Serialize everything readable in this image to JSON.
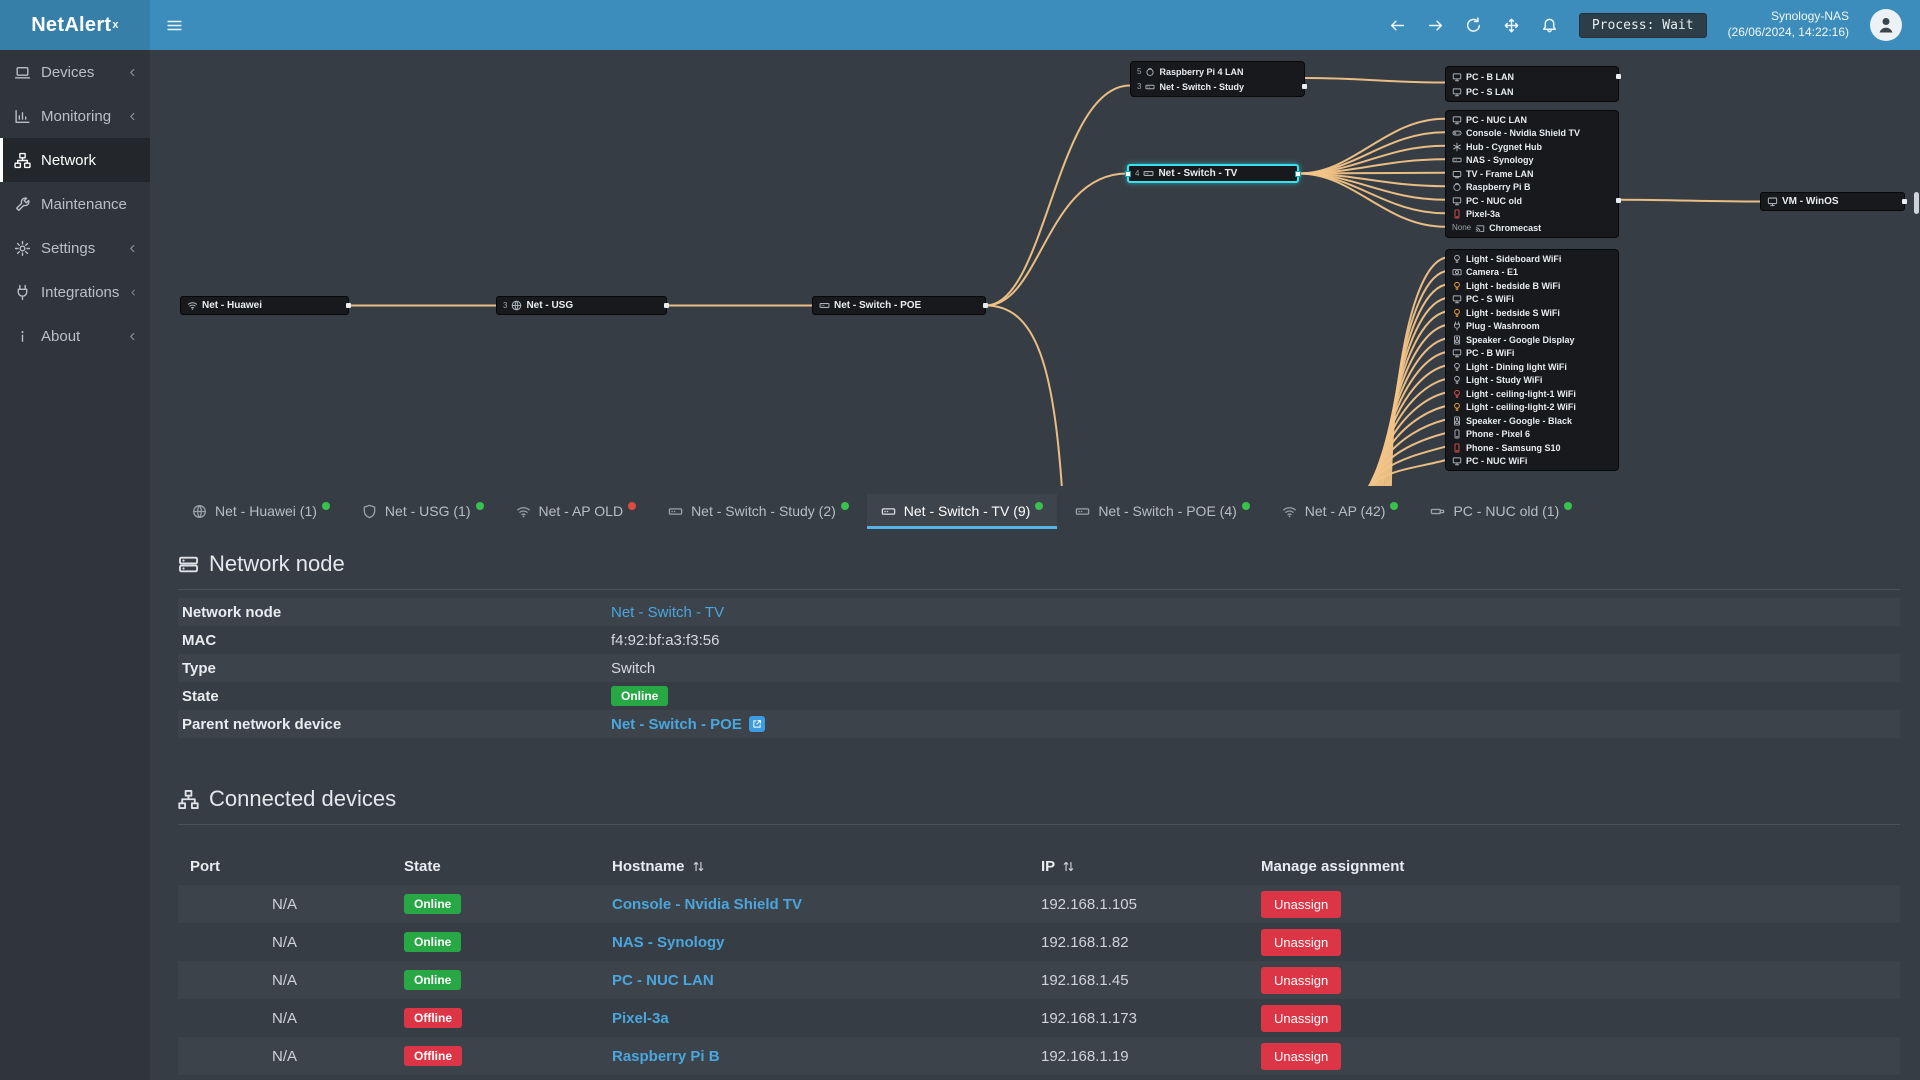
{
  "app": {
    "name": "NetAlert",
    "sup": "x"
  },
  "topbar": {
    "process": "Process: Wait",
    "host": "Synology-NAS",
    "time": "(26/06/2024, 14:22:16)"
  },
  "colors": {
    "accent": "#3c8dbc",
    "line": "#f2c488",
    "online": "#28a745",
    "offline": "#dc3545",
    "link": "#4aa6dc",
    "selection": "#35e3ee"
  },
  "sidebar": {
    "items": [
      {
        "label": "Devices",
        "icon": "laptop",
        "chevron": true
      },
      {
        "label": "Monitoring",
        "icon": "chart",
        "chevron": true
      },
      {
        "label": "Network",
        "icon": "network",
        "active": true
      },
      {
        "label": "Maintenance",
        "icon": "wrench",
        "chevron": true
      },
      {
        "label": "Settings",
        "icon": "gear",
        "chevron": true
      },
      {
        "label": "Integrations",
        "icon": "plug",
        "chevron": true
      },
      {
        "label": "About",
        "icon": "info",
        "chevron": true
      }
    ]
  },
  "topology": {
    "nodes": [
      {
        "id": "huawei",
        "label": "Net - Huawei",
        "icon": "wifi"
      },
      {
        "id": "usg",
        "label": "Net - USG",
        "icon": "globe",
        "prefix": "3"
      },
      {
        "id": "poe",
        "label": "Net - Switch - POE",
        "icon": "switch"
      },
      {
        "id": "tv",
        "label": "Net - Switch - TV",
        "icon": "switch",
        "prefix": "4",
        "selected": true
      },
      {
        "id": "vm",
        "label": "VM - WinOS",
        "icon": "pc"
      }
    ],
    "groups": [
      {
        "id": "study",
        "items": [
          {
            "label": "Raspberry Pi 4 LAN",
            "icon": "pi",
            "prefix": "5"
          },
          {
            "label": "Net - Switch - Study",
            "icon": "switch",
            "prefix": "3"
          }
        ]
      },
      {
        "id": "lan-bs",
        "items": [
          {
            "label": "PC - B LAN",
            "icon": "pc"
          },
          {
            "label": "PC - S LAN",
            "icon": "pc"
          }
        ]
      },
      {
        "id": "tv-devices",
        "items": [
          {
            "label": "PC - NUC LAN",
            "icon": "pc"
          },
          {
            "label": "Console - Nvidia Shield TV",
            "icon": "gamepad"
          },
          {
            "label": "Hub - Cygnet Hub",
            "icon": "hub"
          },
          {
            "label": "NAS - Synology",
            "icon": "nas"
          },
          {
            "label": "TV - Frame LAN",
            "icon": "tv"
          },
          {
            "label": "Raspberry Pi B",
            "icon": "pi"
          },
          {
            "label": "PC - NUC old",
            "icon": "pc"
          },
          {
            "label": "Pixel-3a",
            "icon": "phone",
            "color": "#d9534f"
          },
          {
            "label": "Chromecast",
            "icon": "cast",
            "prefix": "None"
          }
        ]
      },
      {
        "id": "wifi-devices",
        "items": [
          {
            "label": "Light - Sideboard WiFi",
            "icon": "light"
          },
          {
            "label": "Camera - E1",
            "icon": "camera"
          },
          {
            "label": "Light - bedside B WiFi",
            "icon": "light",
            "color": "#e8a33d"
          },
          {
            "label": "PC - S WiFi",
            "icon": "pc"
          },
          {
            "label": "Light - bedside S WiFi",
            "icon": "light",
            "color": "#e8a33d"
          },
          {
            "label": "Plug - Washroom",
            "icon": "plug"
          },
          {
            "label": "Speaker - Google Display",
            "icon": "speaker"
          },
          {
            "label": "PC - B WiFi",
            "icon": "pc"
          },
          {
            "label": "Light - Dining light WiFi",
            "icon": "light"
          },
          {
            "label": "Light - Study WiFi",
            "icon": "light"
          },
          {
            "label": "Light - ceiling-light-1 WiFi",
            "icon": "light",
            "color": "#d9534f"
          },
          {
            "label": "Light - ceiling-light-2 WiFi",
            "icon": "light",
            "color": "#e8a33d"
          },
          {
            "label": "Speaker - Google - Black",
            "icon": "speaker"
          },
          {
            "label": "Phone - Pixel 6",
            "icon": "phone"
          },
          {
            "label": "Phone - Samsung S10",
            "icon": "phone",
            "color": "#d9534f"
          },
          {
            "label": "PC - NUC WiFi",
            "icon": "pc"
          }
        ]
      }
    ]
  },
  "tabs": [
    {
      "label": "Net - Huawei (1)",
      "icon": "globe",
      "dot": "green"
    },
    {
      "label": "Net - USG (1)",
      "icon": "shield",
      "dot": "green"
    },
    {
      "label": "Net - AP OLD",
      "icon": "wifi",
      "dot": "red"
    },
    {
      "label": "Net - Switch - Study (2)",
      "icon": "switch",
      "dot": "green"
    },
    {
      "label": "Net - Switch - TV (9)",
      "icon": "switch",
      "dot": "green",
      "active": true
    },
    {
      "label": "Net - Switch - POE (4)",
      "icon": "switch",
      "dot": "green"
    },
    {
      "label": "Net - AP (42)",
      "icon": "wifi",
      "dot": "green"
    },
    {
      "label": "PC - NUC old (1)",
      "icon": "usb",
      "dot": "green"
    }
  ],
  "network_node": {
    "title": "Network node",
    "rows": [
      {
        "label": "Network node",
        "value": "Net - Switch - TV",
        "kind": "link"
      },
      {
        "label": "MAC",
        "value": "f4:92:bf:a3:f3:56",
        "kind": "text"
      },
      {
        "label": "Type",
        "value": "Switch",
        "kind": "text"
      },
      {
        "label": "State",
        "value": "Online",
        "kind": "badge"
      },
      {
        "label": "Parent network device",
        "value": "Net - Switch - POE",
        "kind": "link_ext"
      }
    ]
  },
  "connected_devices": {
    "title": "Connected devices",
    "columns": [
      {
        "label": "Port"
      },
      {
        "label": "State"
      },
      {
        "label": "Hostname",
        "sortable": true
      },
      {
        "label": "IP",
        "sortable": true
      },
      {
        "label": "Manage assignment"
      }
    ],
    "action_label": "Unassign",
    "rows": [
      {
        "port": "N/A",
        "state": "Online",
        "hostname": "Console - Nvidia Shield TV",
        "ip": "192.168.1.105"
      },
      {
        "port": "N/A",
        "state": "Online",
        "hostname": "NAS - Synology",
        "ip": "192.168.1.82"
      },
      {
        "port": "N/A",
        "state": "Online",
        "hostname": "PC - NUC LAN",
        "ip": "192.168.1.45"
      },
      {
        "port": "N/A",
        "state": "Offline",
        "hostname": "Pixel-3a",
        "ip": "192.168.1.173"
      },
      {
        "port": "N/A",
        "state": "Offline",
        "hostname": "Raspberry Pi B",
        "ip": "192.168.1.19"
      }
    ]
  }
}
